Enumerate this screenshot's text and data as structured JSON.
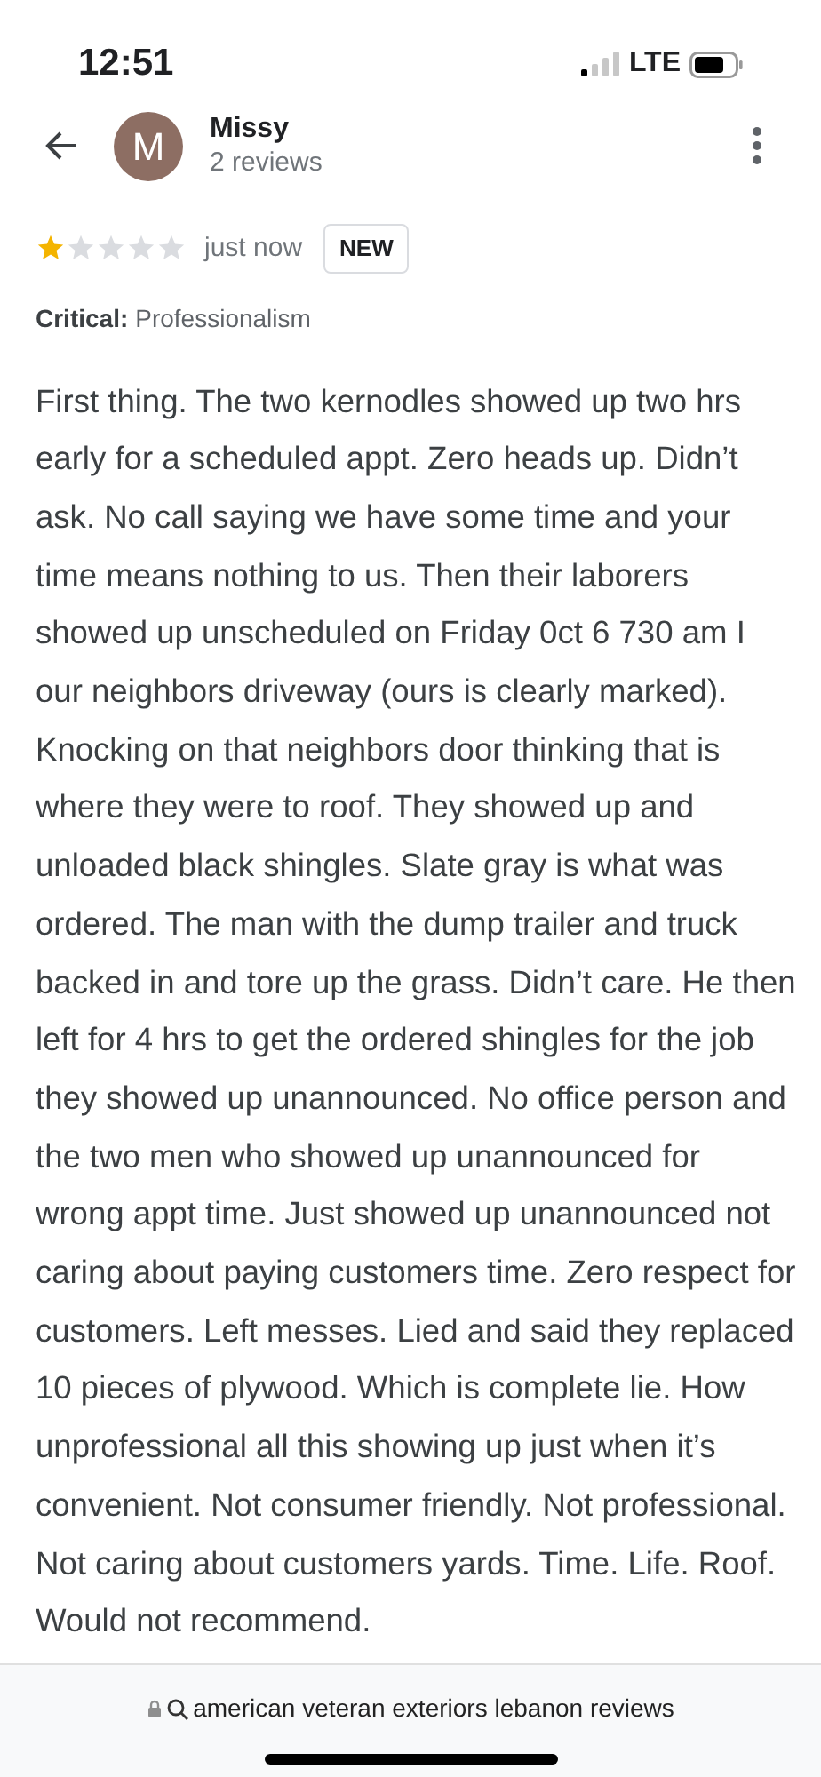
{
  "status_bar": {
    "time": "12:51",
    "network": "LTE"
  },
  "header": {
    "avatar_letter": "M",
    "name": "Missy",
    "subtitle": "2 reviews"
  },
  "review": {
    "stars": 1,
    "time": "just now",
    "badge": "NEW",
    "critical_label": "Critical:",
    "critical_value": "Professionalism",
    "body": "First thing. The two kernodles showed up two hrs early for a scheduled appt. Zero heads up. Didn’t ask. No call saying we have some time and your time means nothing to us. Then their laborers showed up unscheduled on Friday 0ct 6 730 am I our neighbors driveway (ours is clearly marked). Knocking on that neighbors door thinking that is where they were to roof. They showed up and unloaded black shingles. Slate gray is what was ordered. The man with the dump trailer and truck backed in and tore up the grass. Didn’t care. He then left for 4 hrs to get the ordered shingles for the job they showed up unannounced. No office person and the two men who showed up unannounced for wrong appt time. Just showed up unannounced not caring about paying customers time. Zero respect for customers. Left messes. Lied and said they replaced 10 pieces of plywood. Which is complete lie. How unprofessional all this showing up just when it’s convenient. Not consumer friendly. Not professional. Not caring about customers yards. Time. Life. Roof. Would not recommend."
  },
  "address_bar": {
    "text": "american veteran exteriors lebanon reviews"
  }
}
